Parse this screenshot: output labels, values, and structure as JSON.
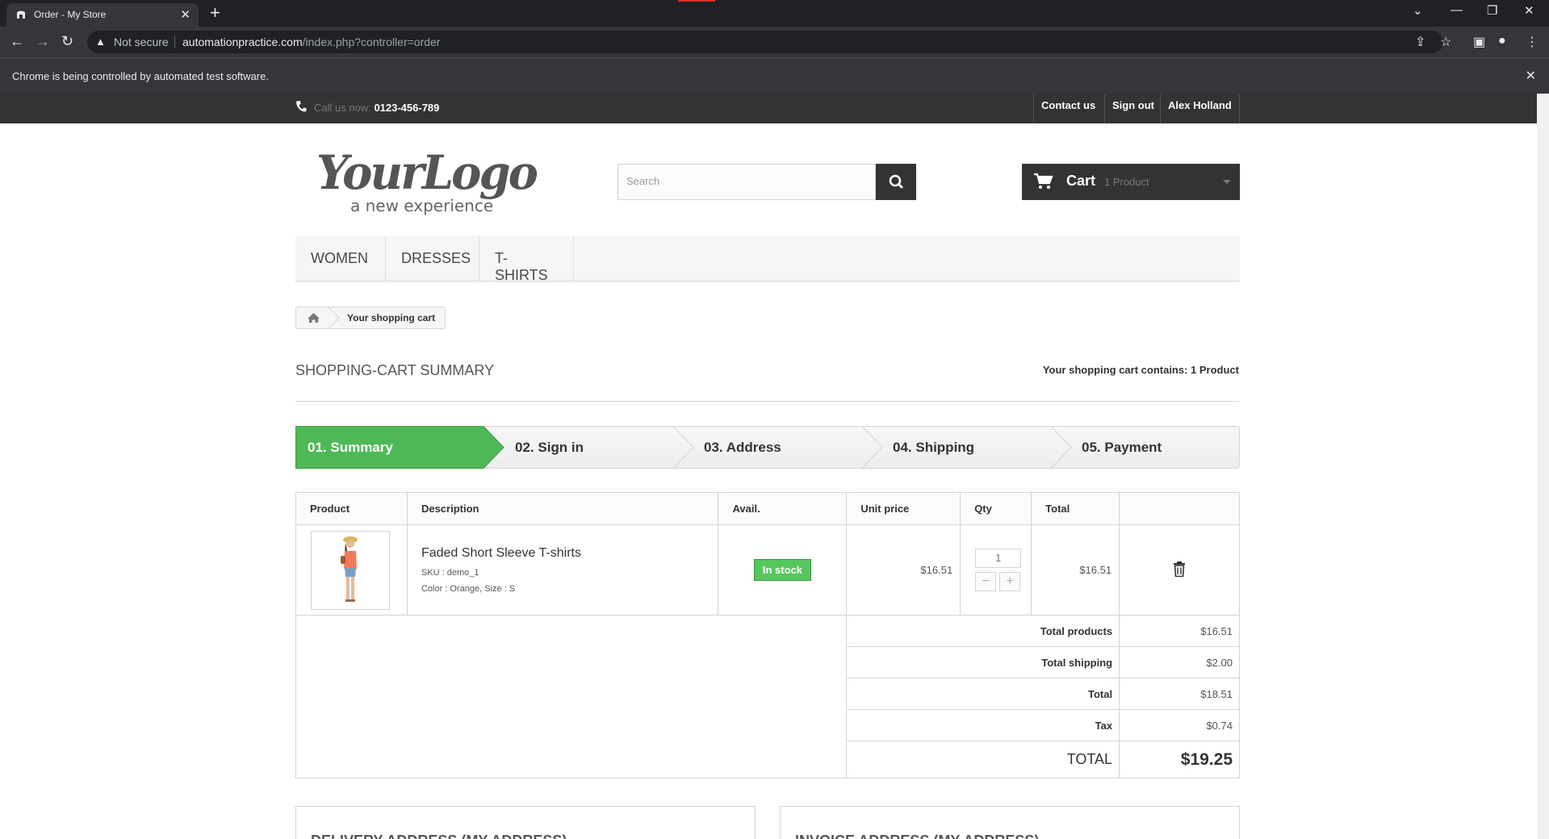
{
  "browser": {
    "tab_title": "Order - My Store",
    "url_host": "automationpractice.com",
    "url_path": "/index.php?controller=order",
    "security_label": "Not secure",
    "infobar_message": "Chrome is being controlled by automated test software."
  },
  "header": {
    "call_us_label": "Call us now:",
    "phone": "0123-456-789",
    "links": [
      "Contact us",
      "Sign out",
      "Alex Holland"
    ],
    "logo_main": "YourLogo",
    "logo_sub": "a new experience",
    "search_placeholder": "Search",
    "cart_label": "Cart",
    "cart_count": "1 Product"
  },
  "menu": {
    "items": [
      "WOMEN",
      "DRESSES",
      "T-SHIRTS"
    ]
  },
  "breadcrumb": {
    "current": "Your shopping cart"
  },
  "summary": {
    "heading": "Shopping-cart summary",
    "contains_text": "Your shopping cart contains: 1 Product"
  },
  "steps": [
    "01. Summary",
    "02. Sign in",
    "03. Address",
    "04. Shipping",
    "05. Payment"
  ],
  "cart_table": {
    "headers": [
      "Product",
      "Description",
      "Avail.",
      "Unit price",
      "Qty",
      "Total",
      ""
    ],
    "items": [
      {
        "name": "Faded Short Sleeve T-shirts",
        "sku": "SKU : demo_1",
        "attributes": "Color : Orange, Size : S",
        "availability": "In stock",
        "unit_price": "$16.51",
        "qty": "1",
        "total": "$16.51"
      }
    ],
    "totals": [
      {
        "label": "Total products",
        "value": "$16.51"
      },
      {
        "label": "Total shipping",
        "value": "$2.00"
      },
      {
        "label": "Total",
        "value": "$18.51"
      },
      {
        "label": "Tax",
        "value": "$0.74"
      }
    ],
    "grand_total_label": "TOTAL",
    "grand_total_value": "$19.25"
  },
  "addresses": {
    "delivery_title": "Delivery address (My address)",
    "invoice_title": "Invoice address (My address)"
  },
  "colors": {
    "accent_green": "#4eb857",
    "dark_bar": "#333333",
    "stock_green": "#55c65e"
  }
}
